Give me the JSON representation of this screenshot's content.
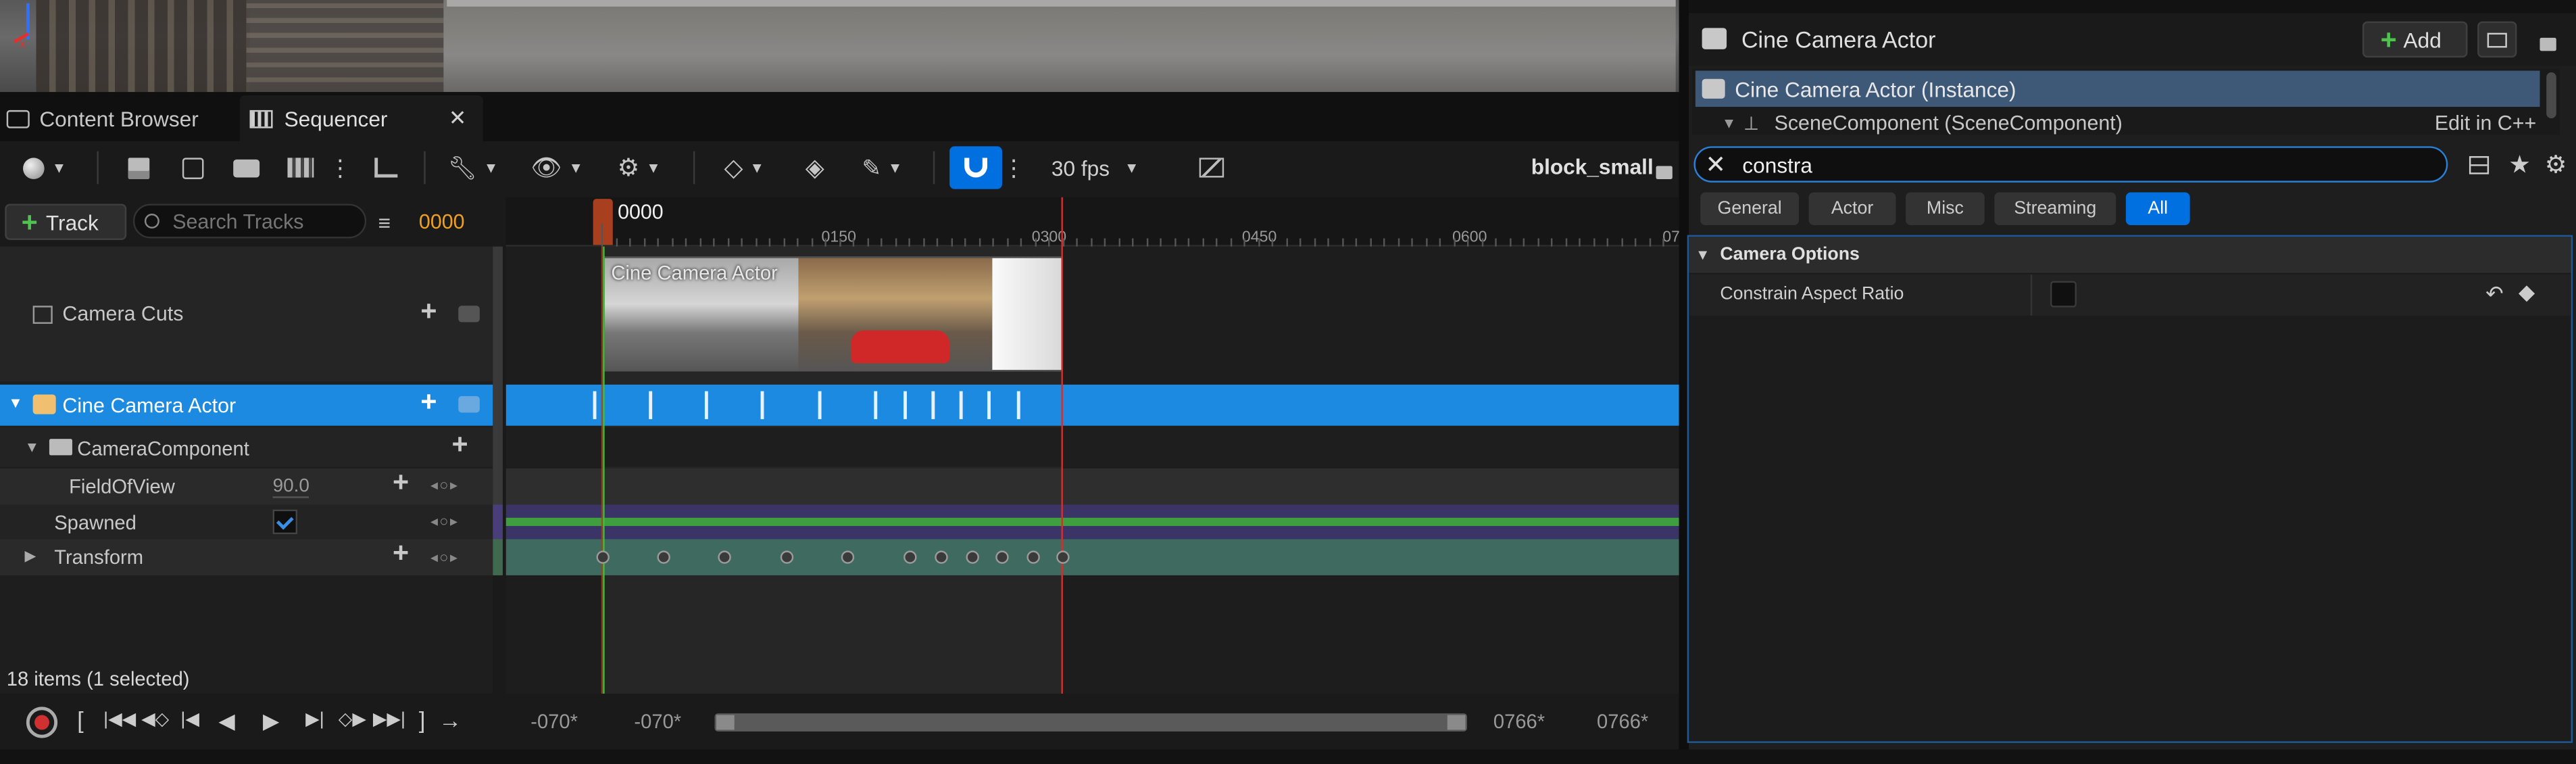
{
  "tabs": [
    {
      "label": "Content Browser",
      "active": false
    },
    {
      "label": "Sequencer",
      "active": true
    }
  ],
  "toolbar": {
    "fps_label": "30 fps",
    "sequence_name": "block_small"
  },
  "tracks_header": {
    "add_track_label": "Track",
    "search_placeholder": "Search Tracks",
    "current_frame": "0000"
  },
  "tracks": {
    "camera_cuts": "Camera Cuts",
    "cine_camera_actor": "Cine Camera Actor",
    "camera_component": "CameraComponent",
    "field_of_view": {
      "label": "FieldOfView",
      "value": "90.0"
    },
    "spawned": {
      "label": "Spawned",
      "checked": true
    },
    "transform": "Transform"
  },
  "items_status": "18 items (1 selected)",
  "timeline": {
    "playhead_label": "0000",
    "ticks": [
      "0150",
      "0300",
      "0450",
      "0600",
      "07"
    ],
    "section_label": "Cine Camera Actor",
    "bottom": {
      "view_start": "-070*",
      "work_start": "-070*",
      "work_end": "0766*",
      "view_end": "0766*"
    }
  },
  "details": {
    "title": "Cine Camera Actor",
    "add_label": "Add",
    "instance_label": "Cine Camera Actor (Instance)",
    "component_label": "SceneComponent (SceneComponent)",
    "edit_label": "Edit in C++",
    "search_value": "constra",
    "filters": [
      "General",
      "Actor",
      "Misc",
      "Streaming",
      "All"
    ],
    "active_filter": "All",
    "category": "Camera Options",
    "property": {
      "label": "Constrain Aspect Ratio",
      "checked": false
    }
  },
  "colors": {
    "accent": "#0070e0",
    "selection_blue": "#1c8ae0",
    "orange_frame": "#f0a020",
    "green_range": "#3fbf3f",
    "red_range": "#d03030"
  }
}
